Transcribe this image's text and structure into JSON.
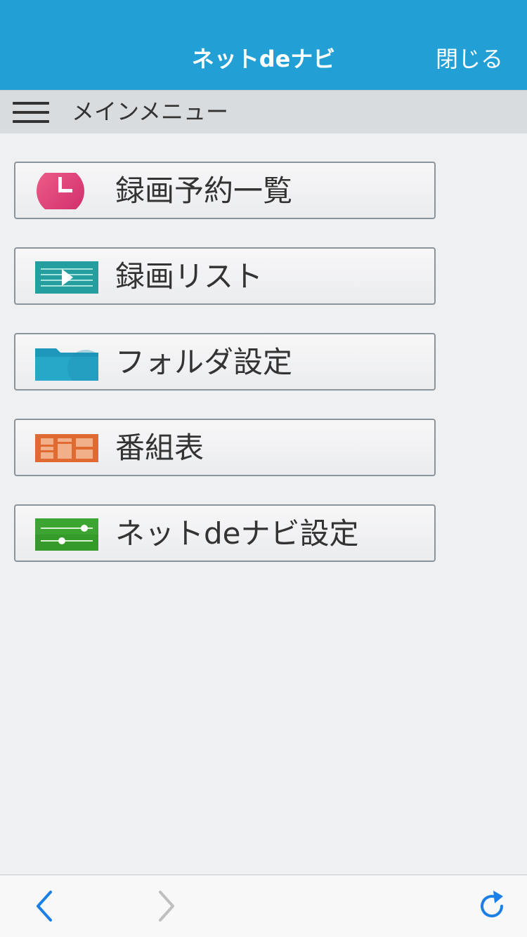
{
  "header": {
    "title": "ネットdeナビ",
    "close_label": "閉じる",
    "bg_color": "#229fd4"
  },
  "menubar": {
    "label": "メインメニュー",
    "icon": "hamburger-menu-icon"
  },
  "menu": {
    "items": [
      {
        "label": "録画予約一覧",
        "icon": "clock-icon",
        "color": "#e23e7c"
      },
      {
        "label": "録画リスト",
        "icon": "video-list-icon",
        "color": "#2aa7a0"
      },
      {
        "label": "フォルダ設定",
        "icon": "folder-icon",
        "color": "#1f97bd"
      },
      {
        "label": "番組表",
        "icon": "program-guide-icon",
        "color": "#e06b32"
      },
      {
        "label": "ネットdeナビ設定",
        "icon": "settings-sliders-icon",
        "color": "#3ca531"
      }
    ]
  },
  "toolbar": {
    "back_icon": "back-arrow-icon",
    "forward_icon": "forward-arrow-icon",
    "reload_icon": "reload-icon",
    "accent_color": "#1b7fe6"
  }
}
